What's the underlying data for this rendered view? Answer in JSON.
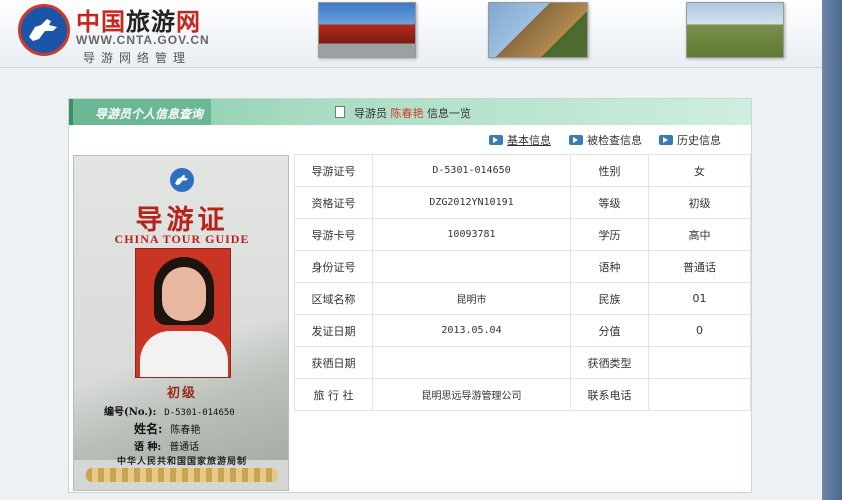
{
  "header": {
    "site_title_red": "中国",
    "site_title_black": "旅游",
    "site_title_red2": "网",
    "url": "WWW.CNTA.GOV.CN",
    "subtitle": "导游网络管理"
  },
  "panel": {
    "title": "导游员个人信息查询",
    "breadcrumb": {
      "prefix": "导游员",
      "name": "陈春艳",
      "suffix": "信息一览"
    }
  },
  "tabs": [
    {
      "label": "基本信息"
    },
    {
      "label": "被检查信息"
    },
    {
      "label": "历史信息"
    }
  ],
  "card": {
    "title": "导游证",
    "title_en": "CHINA TOUR GUIDE",
    "level": "初级",
    "number_label": "编号(No.):",
    "number": "D-5301-014650",
    "name_label": "姓名:",
    "name": "陈春艳",
    "language_label": "语 种:",
    "language": "普通话",
    "issuer": "中华人民共和国国家旅游局制"
  },
  "info": {
    "rows": [
      {
        "label1": "导游证号",
        "value1": "D-5301-014650",
        "label2": "性别",
        "value2": "女"
      },
      {
        "label1": "资格证号",
        "value1": "DZG2012YN10191",
        "label2": "等级",
        "value2": "初级"
      },
      {
        "label1": "导游卡号",
        "value1": "10093781",
        "label2": "学历",
        "value2": "高中"
      },
      {
        "label1": "身份证号",
        "value1": "",
        "label2": "语种",
        "value2": "普通话"
      },
      {
        "label1": "区域名称",
        "value1": "昆明市",
        "label2": "民族",
        "value2": "01"
      },
      {
        "label1": "发证日期",
        "value1": "2013.05.04",
        "label2": "分值",
        "value2": "0"
      },
      {
        "label1": "获徆日期",
        "value1": "",
        "label2": "获徆类型",
        "value2": ""
      },
      {
        "label1": "旅 行 社",
        "value1": "昆明思远导游管理公司",
        "label2": "联系电话",
        "value2": ""
      }
    ]
  },
  "colors": {
    "brand_red": "#c8261c",
    "panel_green": "#7ec7a3",
    "breadcrumb_name": "#d23b2a"
  }
}
